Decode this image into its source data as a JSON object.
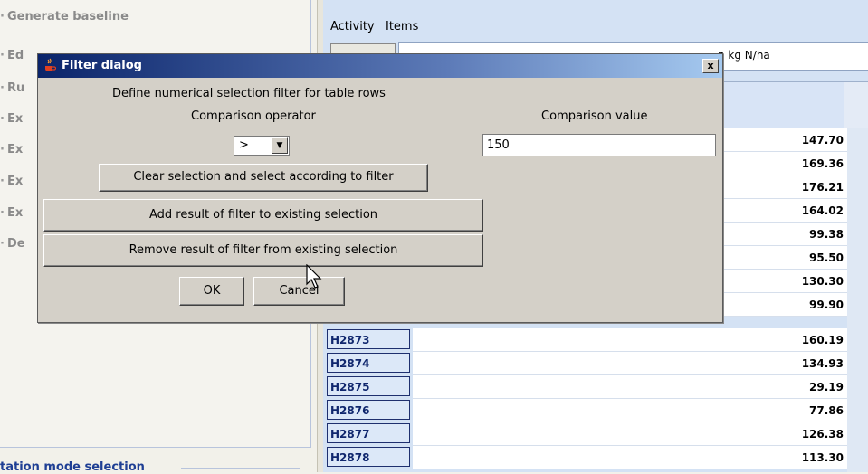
{
  "left_panel": {
    "items": [
      {
        "label": "Generate baseline"
      },
      {
        "label": "Ed"
      },
      {
        "label": "Ru"
      },
      {
        "label": "Ex"
      },
      {
        "label": "Ex"
      },
      {
        "label": "Ex"
      },
      {
        "label": "Ex"
      },
      {
        "label": "De"
      }
    ],
    "mode_selection_label": "tation mode selection"
  },
  "right_panel": {
    "tabs": [
      "Activity",
      "Items"
    ],
    "value_label_fragment": "n kg N/ha",
    "rows": [
      {
        "id": "",
        "value": "147.70"
      },
      {
        "id": "",
        "value": "169.36"
      },
      {
        "id": "",
        "value": "176.21"
      },
      {
        "id": "",
        "value": "164.02"
      },
      {
        "id": "",
        "value": "99.38"
      },
      {
        "id": "",
        "value": "95.50"
      },
      {
        "id": "",
        "value": "130.30"
      },
      {
        "id": "",
        "value": "99.90"
      },
      {
        "id": "H2873",
        "value": "160.19"
      },
      {
        "id": "H2874",
        "value": "134.93"
      },
      {
        "id": "H2875",
        "value": "29.19"
      },
      {
        "id": "H2876",
        "value": "77.86"
      },
      {
        "id": "H2877",
        "value": "126.38"
      },
      {
        "id": "H2878",
        "value": "113.30"
      }
    ]
  },
  "dialog": {
    "title": "Filter dialog",
    "close_label": "x",
    "description": "Define numerical selection filter for table rows",
    "operator_label": "Comparison operator",
    "operator_value": ">",
    "value_label": "Comparison value",
    "value": "150",
    "clear_select_label": "Clear selection and select according to filter",
    "add_label": "Add result of filter to existing selection",
    "remove_label": "Remove result of filter from existing selection",
    "ok_label": "OK",
    "cancel_label": "Cancel"
  },
  "colors": {
    "title_bar": "#0a246a",
    "dialog_bg": "#d4d0c8",
    "row_id_text": "#10276e",
    "table_bg": "#d4e2f4"
  }
}
